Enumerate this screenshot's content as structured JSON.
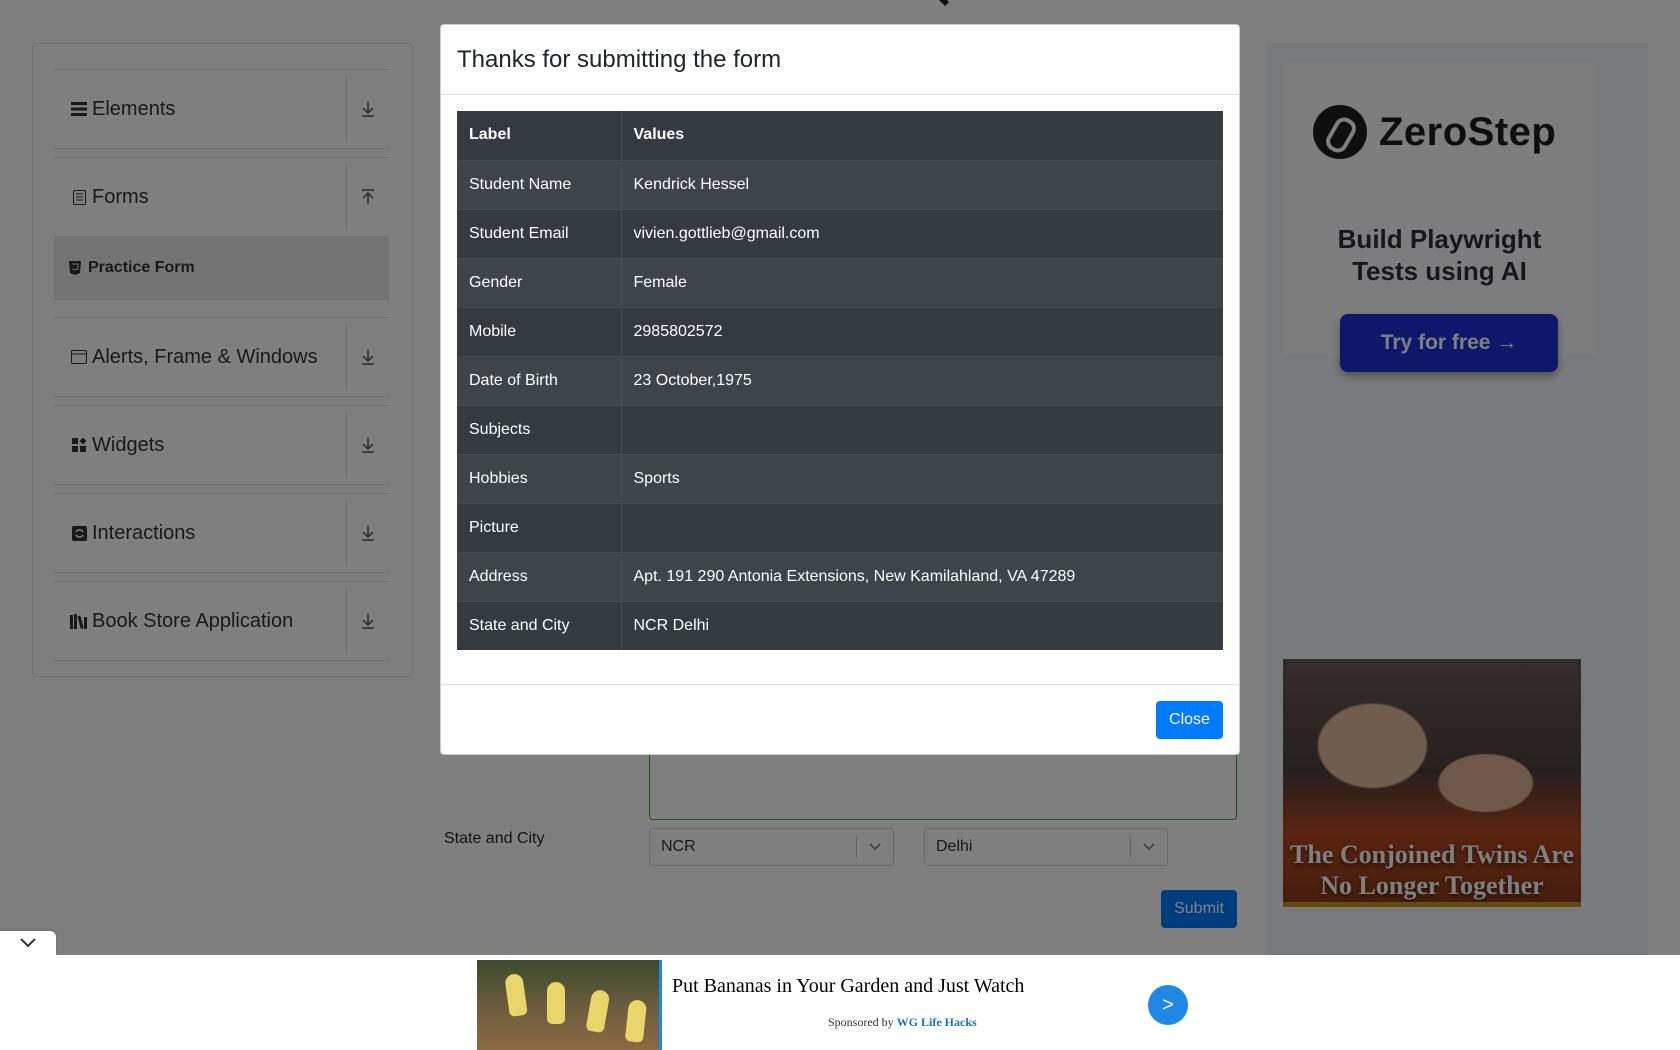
{
  "sidebar": {
    "groups": [
      {
        "label": "Elements",
        "icon": "hamburger-icon",
        "toggle": "download-arrow-icon"
      },
      {
        "label": "Forms",
        "icon": "document-icon",
        "toggle": "upload-arrow-icon"
      },
      {
        "label": "Alerts, Frame & Windows",
        "icon": "window-icon",
        "toggle": "download-arrow-icon"
      },
      {
        "label": "Widgets",
        "icon": "widgets-icon",
        "toggle": "download-arrow-icon"
      },
      {
        "label": "Interactions",
        "icon": "interactions-icon",
        "toggle": "download-arrow-icon"
      },
      {
        "label": "Book Store Application",
        "icon": "books-icon",
        "toggle": "download-arrow-icon"
      }
    ],
    "active_item": {
      "label": "Practice Form",
      "icon": "html5-icon"
    }
  },
  "form": {
    "state_city_label": "State and City",
    "state_value": "NCR",
    "city_value": "Delhi",
    "submit_label": "Submit"
  },
  "modal": {
    "title": "Thanks for submitting the form",
    "headers": {
      "label": "Label",
      "values": "Values"
    },
    "rows": [
      {
        "label": "Student Name",
        "value": "Kendrick Hessel"
      },
      {
        "label": "Student Email",
        "value": "vivien.gottlieb@gmail.com"
      },
      {
        "label": "Gender",
        "value": "Female"
      },
      {
        "label": "Mobile",
        "value": "2985802572"
      },
      {
        "label": "Date of Birth",
        "value": "23 October,1975"
      },
      {
        "label": "Subjects",
        "value": ""
      },
      {
        "label": "Hobbies",
        "value": "Sports"
      },
      {
        "label": "Picture",
        "value": ""
      },
      {
        "label": "Address",
        "value": "Apt. 191 290 Antonia Extensions, New Kamilahland, VA 47289"
      },
      {
        "label": "State and City",
        "value": "NCR Delhi"
      }
    ],
    "close_label": "Close"
  },
  "ads": {
    "zerostep": {
      "brand": "ZeroStep",
      "tagline_line1": "Build Playwright",
      "tagline_line2": "Tests using AI",
      "cta": "Try for free →"
    },
    "twins": {
      "line1": "The Conjoined Twins Are",
      "line2": "No Longer Together"
    },
    "bottom": {
      "title": "Put Bananas in Your Garden and Just Watch",
      "sponsored_prefix": "Sponsored by",
      "sponsor": "WG Life Hacks",
      "arrow": ">"
    }
  },
  "colors": {
    "primary": "#007bff",
    "modal_table_bg": "#343a40",
    "zerostep_cta": "#1b2fd9",
    "textarea_border": "#28a745"
  }
}
